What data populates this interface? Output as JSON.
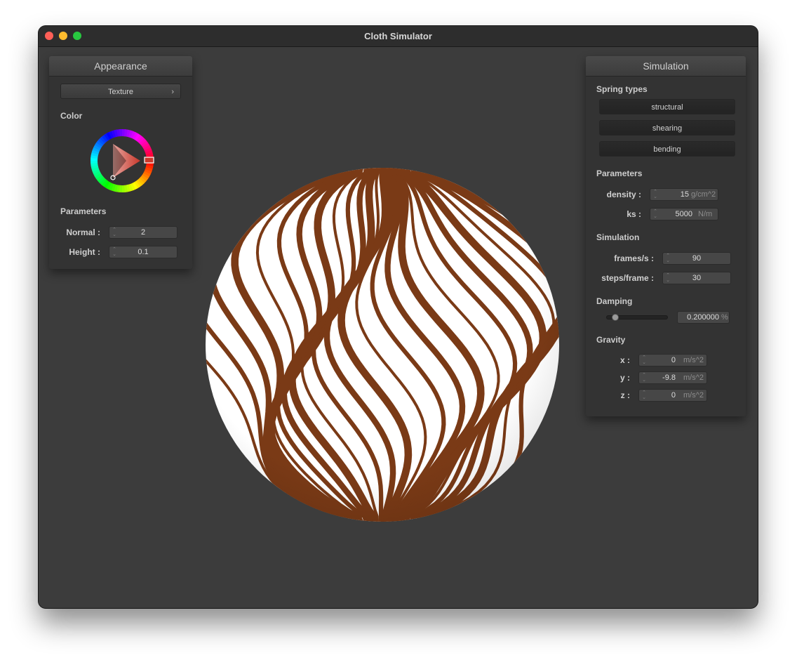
{
  "window": {
    "title": "Cloth Simulator"
  },
  "appearance": {
    "header": "Appearance",
    "texture_button": "Texture",
    "color_label": "Color",
    "params_label": "Parameters",
    "normal": {
      "label": "Normal :",
      "value": "2"
    },
    "height": {
      "label": "Height :",
      "value": "0.1"
    },
    "color_hex": "#c8382b"
  },
  "simulation": {
    "header": "Simulation",
    "spring_types_label": "Spring types",
    "spring_buttons": [
      "structural",
      "shearing",
      "bending"
    ],
    "parameters_label": "Parameters",
    "density": {
      "label": "density :",
      "value": "15",
      "unit": "g/cm^2"
    },
    "ks": {
      "label": "ks :",
      "value": "5000",
      "unit": "N/m"
    },
    "simulation_label": "Simulation",
    "fps": {
      "label": "frames/s :",
      "value": "90"
    },
    "steps": {
      "label": "steps/frame :",
      "value": "30"
    },
    "damping_label": "Damping",
    "damping": {
      "value": "0.200000",
      "unit": "%",
      "fraction": 0.2
    },
    "gravity_label": "Gravity",
    "gx": {
      "label": "x :",
      "value": "0",
      "unit": "m/s^2"
    },
    "gy": {
      "label": "y :",
      "value": "-9.8",
      "unit": "m/s^2"
    },
    "gz": {
      "label": "z :",
      "value": "0",
      "unit": "m/s^2"
    }
  },
  "viewport": {
    "object": "textured sphere",
    "stripe_color": "#7a3a16"
  }
}
